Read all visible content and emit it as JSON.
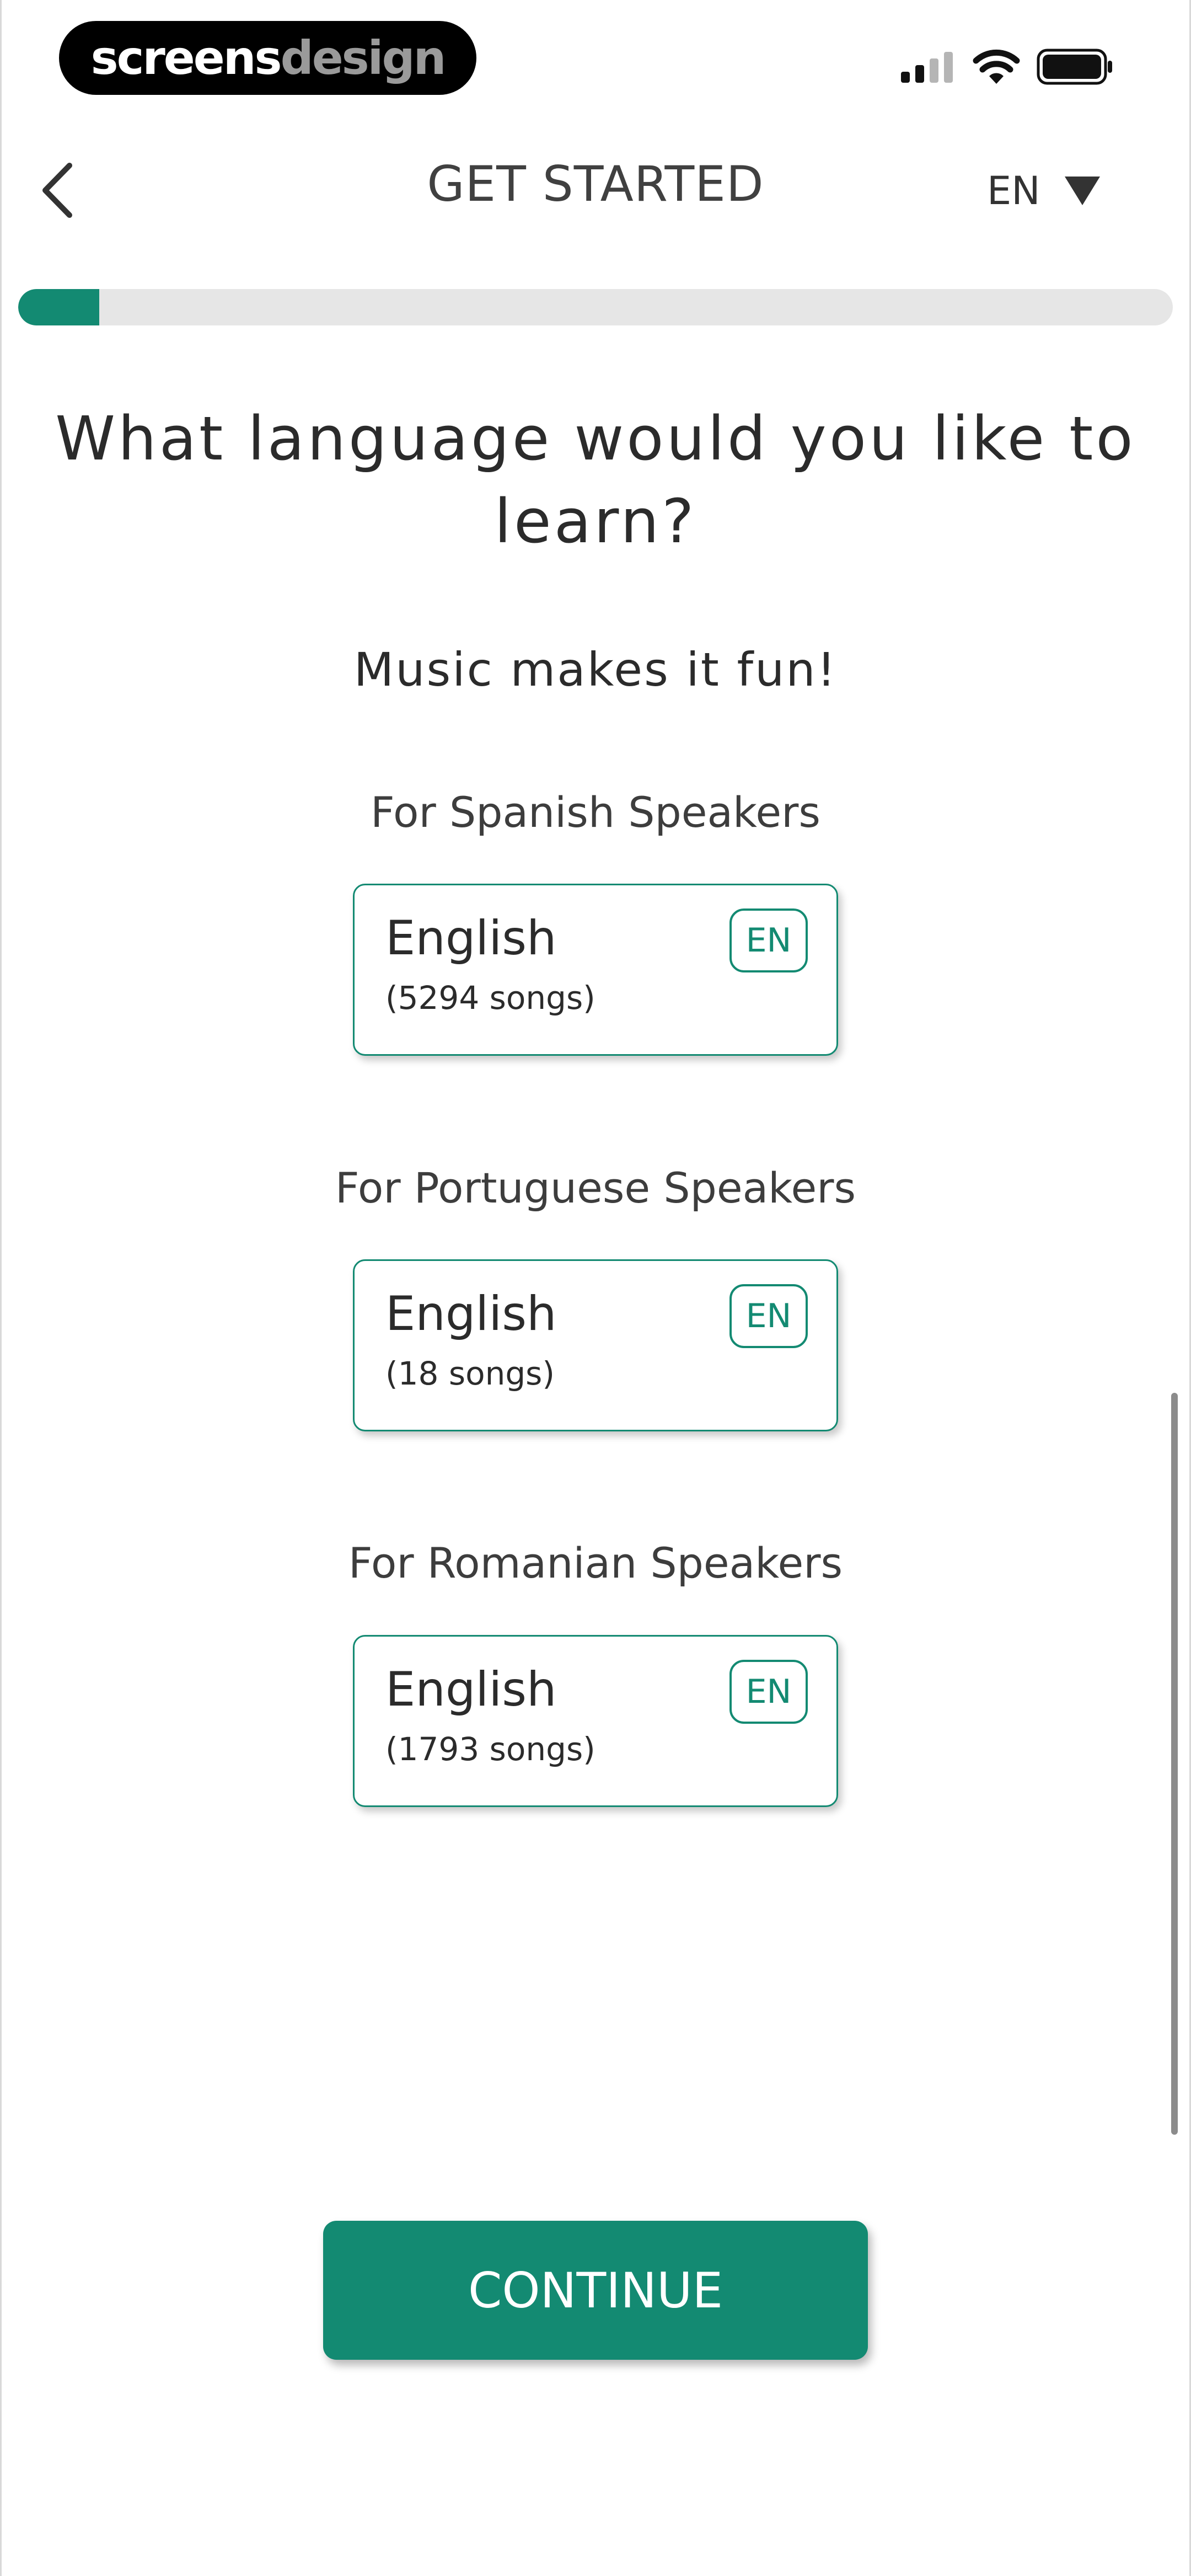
{
  "status_bar": {
    "brand_part1": "screens",
    "brand_part2": "design",
    "icons": [
      "cellular-signal-icon",
      "wifi-icon",
      "battery-icon"
    ]
  },
  "header": {
    "back_icon": "chevron-left-icon",
    "title": "GET STARTED",
    "language_code": "EN",
    "dropdown_icon": "triangle-down-icon"
  },
  "progress": {
    "value": 0.07
  },
  "main": {
    "question": "What language would you like to learn?",
    "subtitle": "Music makes it fun!",
    "sections": [
      {
        "label": "For Spanish Speakers",
        "card": {
          "language": "English",
          "songs": "(5294 songs)",
          "badge": "EN"
        }
      },
      {
        "label": "For Portuguese Speakers",
        "card": {
          "language": "English",
          "songs": "(18 songs)",
          "badge": "EN"
        }
      },
      {
        "label": "For Romanian Speakers",
        "card": {
          "language": "English",
          "songs": "(1793 songs)",
          "badge": "EN"
        }
      }
    ]
  },
  "footer": {
    "continue_label": "CONTINUE"
  },
  "colors": {
    "accent": "#138a72",
    "progress_track": "#e6e6e6",
    "text": "#333333"
  }
}
